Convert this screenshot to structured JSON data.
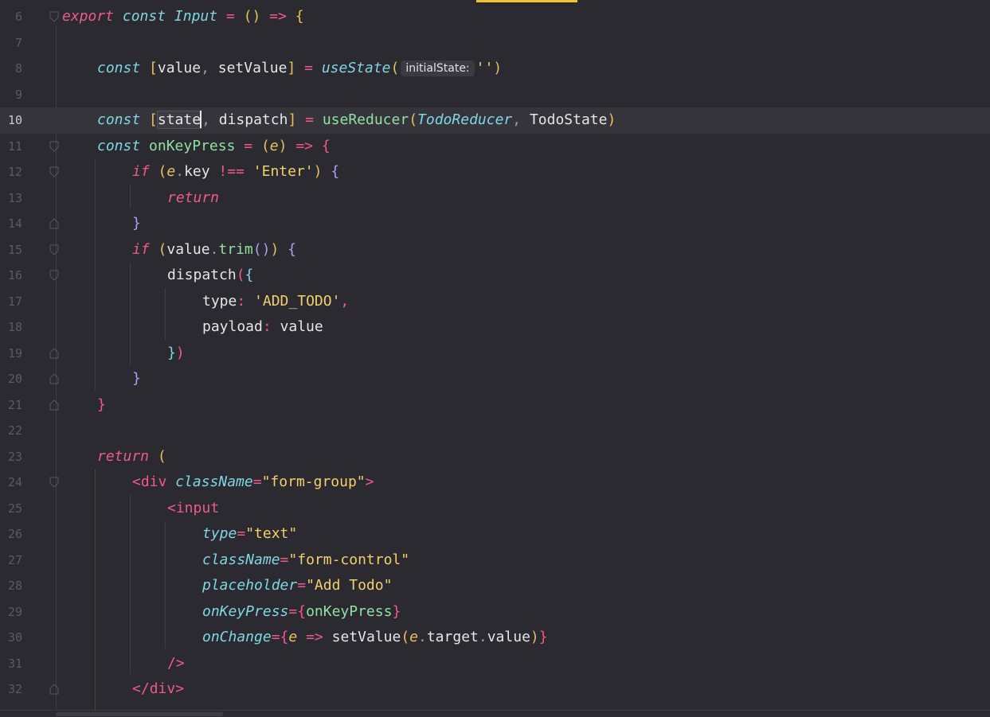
{
  "editor": {
    "current_line": "10",
    "lines": [
      {
        "n": "6"
      },
      {
        "n": "7"
      },
      {
        "n": "8"
      },
      {
        "n": "9"
      },
      {
        "n": "10"
      },
      {
        "n": "11"
      },
      {
        "n": "12"
      },
      {
        "n": "13"
      },
      {
        "n": "14"
      },
      {
        "n": "15"
      },
      {
        "n": "16"
      },
      {
        "n": "17"
      },
      {
        "n": "18"
      },
      {
        "n": "19"
      },
      {
        "n": "20"
      },
      {
        "n": "21"
      },
      {
        "n": "22"
      },
      {
        "n": "23"
      },
      {
        "n": "24"
      },
      {
        "n": "25"
      },
      {
        "n": "26"
      },
      {
        "n": "27"
      },
      {
        "n": "28"
      },
      {
        "n": "29"
      },
      {
        "n": "30"
      },
      {
        "n": "31"
      },
      {
        "n": "32"
      }
    ],
    "tokens": {
      "export": "export",
      "const": "const",
      "component_name": "Input",
      "value": "value",
      "setValue": "setValue",
      "useState": "useState",
      "param_hint": "initialState:",
      "empty_string": "''",
      "state": "state",
      "dispatch": "dispatch",
      "useReducer": "useReducer",
      "TodoReducer": "TodoReducer",
      "TodoState": "TodoState",
      "onKeyPress": "onKeyPress",
      "e": "e",
      "if": "if",
      "key": "key",
      "enter_string": "'Enter'",
      "return": "return",
      "trim": "trim",
      "type_key": "type",
      "add_todo_string": "'ADD_TODO'",
      "payload_key": "payload",
      "div_tag": "div",
      "className_attr": "className",
      "form_group_string": "\"form-group\"",
      "input_tag": "input",
      "type_attr": "type",
      "text_string": "\"text\"",
      "form_control_string": "\"form-control\"",
      "placeholder_attr": "placeholder",
      "add_todo_placeholder": "\"Add Todo\"",
      "onKeyPress_attr": "onKeyPress",
      "onChange_attr": "onChange",
      "target": "target"
    }
  },
  "colors": {
    "background": "#2b2a30",
    "current_line": "#35343b",
    "keyword": "#ee5a8a",
    "function": "#7fd6e4",
    "string": "#f2d06b",
    "top_marker": "#f2c230"
  }
}
